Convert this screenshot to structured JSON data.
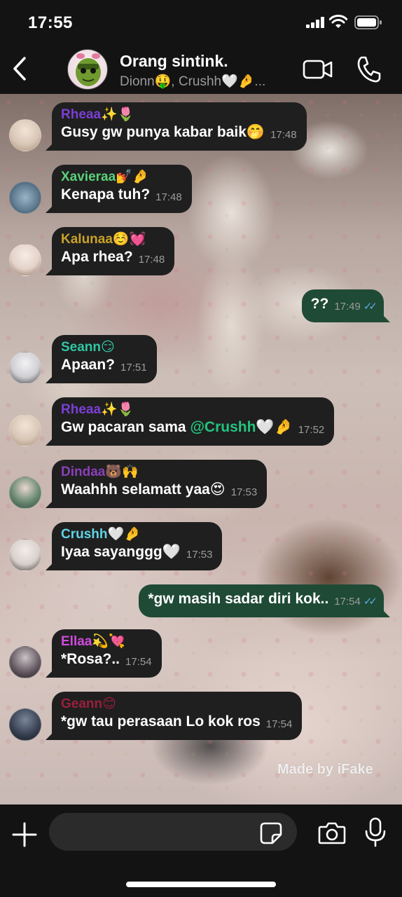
{
  "status_bar": {
    "time": "17:55"
  },
  "header": {
    "title": "Orang sintink.",
    "subtitle": "Dionn🤑, Crushh🤍🤌..."
  },
  "messages": [
    {
      "direction": "in",
      "sender": "Rheaa✨🌷",
      "sender_color": "#7b3fd6",
      "text": "Gusy gw punya kabar baik🤭",
      "time": "17:48",
      "avatar_color": "#d9c7b6"
    },
    {
      "direction": "in",
      "sender": "Xavieraa💅🤌",
      "sender_color": "#5ad17a",
      "text": "Kenapa tuh?",
      "time": "17:48",
      "avatar_color": "#5e7a8f"
    },
    {
      "direction": "in",
      "sender": "Kalunaa☺️💓",
      "sender_color": "#c9a227",
      "text": "Apa rhea?",
      "time": "17:48",
      "avatar_color": "#e3d2c8"
    },
    {
      "direction": "out",
      "text": "??",
      "time": "17:49"
    },
    {
      "direction": "in",
      "sender": "Seann😏",
      "sender_color": "#2fc7a4",
      "text": "Apaan?",
      "time": "17:51",
      "avatar_color": "#cfcfd3"
    },
    {
      "direction": "in",
      "sender": "Rheaa✨🌷",
      "sender_color": "#7b3fd6",
      "text_before": "Gw pacaran sama ",
      "mention": "@Crushh🤍🤌",
      "time": "17:52",
      "avatar_color": "#d9c7b6"
    },
    {
      "direction": "in",
      "sender": "Dindaa🐻🙌",
      "sender_color": "#8a3fb8",
      "text": "Waahhh selamatt yaa😍",
      "time": "17:53",
      "avatar_color": "#2d4a3e"
    },
    {
      "direction": "in",
      "sender": "Crushh🤍🤌",
      "sender_color": "#5fd3e6",
      "text": "Iyaa sayanggg🤍",
      "time": "17:53",
      "avatar_color": "#d8d0cc"
    },
    {
      "direction": "out",
      "text": "*gw masih sadar diri kok..",
      "time": "17:54"
    },
    {
      "direction": "in",
      "sender": "Ellaa💫💘",
      "sender_color": "#d04be0",
      "text": "*Rosa?..",
      "time": "17:54",
      "avatar_color": "#3a3338"
    },
    {
      "direction": "in",
      "sender": "Geann😊",
      "sender_color": "#9a1f3c",
      "text": "*gw tau perasaan Lo kok ros",
      "time": "17:54",
      "avatar_color": "#2c3340"
    }
  ],
  "watermark": "Made by iFake",
  "composer": {
    "placeholder": ""
  },
  "colors": {
    "outgoing_bubble": "#1f4a36",
    "incoming_bubble": "#1f1f1f",
    "read_ticks": "#5aa9e6",
    "mention": "#23c47d"
  }
}
